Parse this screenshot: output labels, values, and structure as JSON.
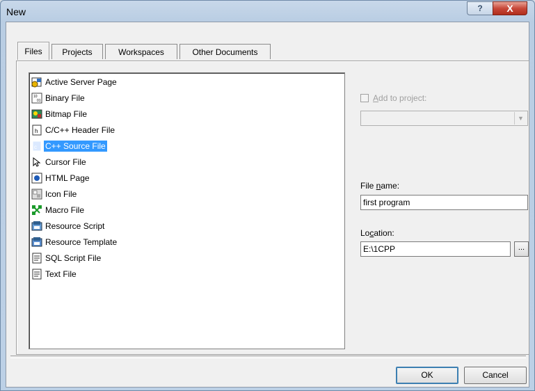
{
  "window": {
    "title": "New",
    "help_glyph": "?",
    "close_glyph": "X"
  },
  "tabs": [
    {
      "label": "Files",
      "active": true
    },
    {
      "label": "Projects",
      "active": false
    },
    {
      "label": "Workspaces",
      "active": false
    },
    {
      "label": "Other Documents",
      "active": false
    }
  ],
  "file_types": [
    {
      "label": "Active Server Page",
      "icon": "asp-icon",
      "selected": false
    },
    {
      "label": "Binary File",
      "icon": "binary-file-icon",
      "selected": false
    },
    {
      "label": "Bitmap File",
      "icon": "bitmap-icon",
      "selected": false
    },
    {
      "label": "C/C++ Header File",
      "icon": "header-file-icon",
      "selected": false
    },
    {
      "label": "C++ Source File",
      "icon": "cpp-source-icon",
      "selected": true
    },
    {
      "label": "Cursor File",
      "icon": "cursor-file-icon",
      "selected": false
    },
    {
      "label": "HTML Page",
      "icon": "html-page-icon",
      "selected": false
    },
    {
      "label": "Icon File",
      "icon": "icon-file-icon",
      "selected": false
    },
    {
      "label": "Macro File",
      "icon": "macro-file-icon",
      "selected": false
    },
    {
      "label": "Resource Script",
      "icon": "resource-script-icon",
      "selected": false
    },
    {
      "label": "Resource Template",
      "icon": "resource-template-icon",
      "selected": false
    },
    {
      "label": "SQL Script File",
      "icon": "sql-script-icon",
      "selected": false
    },
    {
      "label": "Text File",
      "icon": "text-file-icon",
      "selected": false
    }
  ],
  "add_to_project": {
    "prefix": "",
    "accel": "A",
    "rest": "dd to project:",
    "checked": false,
    "enabled": false
  },
  "project_combo": {
    "value": "",
    "arrow": "▼"
  },
  "file_name": {
    "label_pre": "File ",
    "label_accel": "n",
    "label_post": "ame:",
    "value": "first program"
  },
  "location": {
    "label_pre": "Lo",
    "label_accel": "c",
    "label_post": "ation:",
    "value": "E:\\1CPP",
    "browse_label": "..."
  },
  "buttons": {
    "ok": "OK",
    "cancel": "Cancel"
  },
  "colors": {
    "selection": "#3399ff",
    "close_button": "#c8493a"
  }
}
